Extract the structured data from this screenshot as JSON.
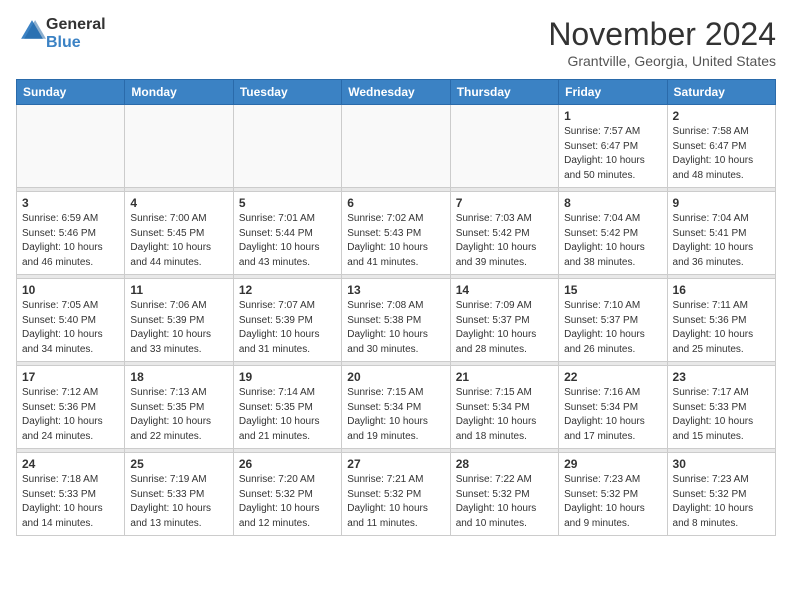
{
  "header": {
    "logo_line1": "General",
    "logo_line2": "Blue",
    "month": "November 2024",
    "location": "Grantville, Georgia, United States"
  },
  "weekdays": [
    "Sunday",
    "Monday",
    "Tuesday",
    "Wednesday",
    "Thursday",
    "Friday",
    "Saturday"
  ],
  "weeks": [
    [
      {
        "day": "",
        "info": ""
      },
      {
        "day": "",
        "info": ""
      },
      {
        "day": "",
        "info": ""
      },
      {
        "day": "",
        "info": ""
      },
      {
        "day": "",
        "info": ""
      },
      {
        "day": "1",
        "info": "Sunrise: 7:57 AM\nSunset: 6:47 PM\nDaylight: 10 hours\nand 50 minutes."
      },
      {
        "day": "2",
        "info": "Sunrise: 7:58 AM\nSunset: 6:47 PM\nDaylight: 10 hours\nand 48 minutes."
      }
    ],
    [
      {
        "day": "3",
        "info": "Sunrise: 6:59 AM\nSunset: 5:46 PM\nDaylight: 10 hours\nand 46 minutes."
      },
      {
        "day": "4",
        "info": "Sunrise: 7:00 AM\nSunset: 5:45 PM\nDaylight: 10 hours\nand 44 minutes."
      },
      {
        "day": "5",
        "info": "Sunrise: 7:01 AM\nSunset: 5:44 PM\nDaylight: 10 hours\nand 43 minutes."
      },
      {
        "day": "6",
        "info": "Sunrise: 7:02 AM\nSunset: 5:43 PM\nDaylight: 10 hours\nand 41 minutes."
      },
      {
        "day": "7",
        "info": "Sunrise: 7:03 AM\nSunset: 5:42 PM\nDaylight: 10 hours\nand 39 minutes."
      },
      {
        "day": "8",
        "info": "Sunrise: 7:04 AM\nSunset: 5:42 PM\nDaylight: 10 hours\nand 38 minutes."
      },
      {
        "day": "9",
        "info": "Sunrise: 7:04 AM\nSunset: 5:41 PM\nDaylight: 10 hours\nand 36 minutes."
      }
    ],
    [
      {
        "day": "10",
        "info": "Sunrise: 7:05 AM\nSunset: 5:40 PM\nDaylight: 10 hours\nand 34 minutes."
      },
      {
        "day": "11",
        "info": "Sunrise: 7:06 AM\nSunset: 5:39 PM\nDaylight: 10 hours\nand 33 minutes."
      },
      {
        "day": "12",
        "info": "Sunrise: 7:07 AM\nSunset: 5:39 PM\nDaylight: 10 hours\nand 31 minutes."
      },
      {
        "day": "13",
        "info": "Sunrise: 7:08 AM\nSunset: 5:38 PM\nDaylight: 10 hours\nand 30 minutes."
      },
      {
        "day": "14",
        "info": "Sunrise: 7:09 AM\nSunset: 5:37 PM\nDaylight: 10 hours\nand 28 minutes."
      },
      {
        "day": "15",
        "info": "Sunrise: 7:10 AM\nSunset: 5:37 PM\nDaylight: 10 hours\nand 26 minutes."
      },
      {
        "day": "16",
        "info": "Sunrise: 7:11 AM\nSunset: 5:36 PM\nDaylight: 10 hours\nand 25 minutes."
      }
    ],
    [
      {
        "day": "17",
        "info": "Sunrise: 7:12 AM\nSunset: 5:36 PM\nDaylight: 10 hours\nand 24 minutes."
      },
      {
        "day": "18",
        "info": "Sunrise: 7:13 AM\nSunset: 5:35 PM\nDaylight: 10 hours\nand 22 minutes."
      },
      {
        "day": "19",
        "info": "Sunrise: 7:14 AM\nSunset: 5:35 PM\nDaylight: 10 hours\nand 21 minutes."
      },
      {
        "day": "20",
        "info": "Sunrise: 7:15 AM\nSunset: 5:34 PM\nDaylight: 10 hours\nand 19 minutes."
      },
      {
        "day": "21",
        "info": "Sunrise: 7:15 AM\nSunset: 5:34 PM\nDaylight: 10 hours\nand 18 minutes."
      },
      {
        "day": "22",
        "info": "Sunrise: 7:16 AM\nSunset: 5:34 PM\nDaylight: 10 hours\nand 17 minutes."
      },
      {
        "day": "23",
        "info": "Sunrise: 7:17 AM\nSunset: 5:33 PM\nDaylight: 10 hours\nand 15 minutes."
      }
    ],
    [
      {
        "day": "24",
        "info": "Sunrise: 7:18 AM\nSunset: 5:33 PM\nDaylight: 10 hours\nand 14 minutes."
      },
      {
        "day": "25",
        "info": "Sunrise: 7:19 AM\nSunset: 5:33 PM\nDaylight: 10 hours\nand 13 minutes."
      },
      {
        "day": "26",
        "info": "Sunrise: 7:20 AM\nSunset: 5:32 PM\nDaylight: 10 hours\nand 12 minutes."
      },
      {
        "day": "27",
        "info": "Sunrise: 7:21 AM\nSunset: 5:32 PM\nDaylight: 10 hours\nand 11 minutes."
      },
      {
        "day": "28",
        "info": "Sunrise: 7:22 AM\nSunset: 5:32 PM\nDaylight: 10 hours\nand 10 minutes."
      },
      {
        "day": "29",
        "info": "Sunrise: 7:23 AM\nSunset: 5:32 PM\nDaylight: 10 hours\nand 9 minutes."
      },
      {
        "day": "30",
        "info": "Sunrise: 7:23 AM\nSunset: 5:32 PM\nDaylight: 10 hours\nand 8 minutes."
      }
    ]
  ]
}
